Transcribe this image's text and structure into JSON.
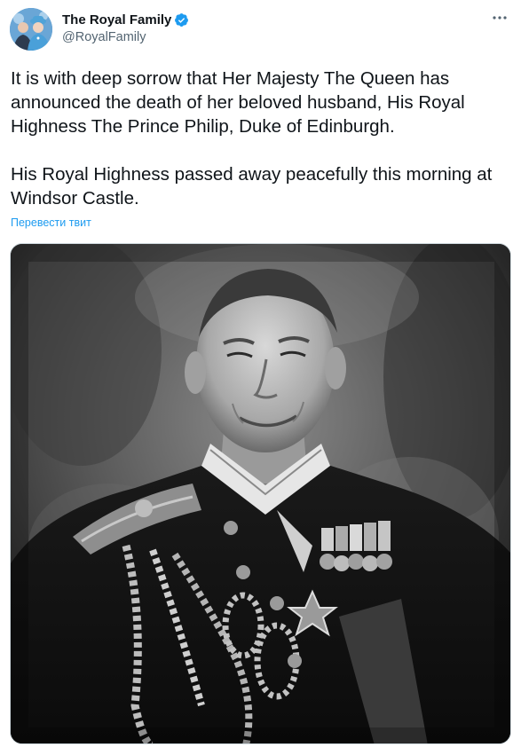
{
  "tweet": {
    "author": {
      "display_name": "The Royal Family",
      "handle": "@RoyalFamily",
      "verified": true
    },
    "more_icon": "more-horizontal-icon",
    "text_paragraphs": [
      "It is with deep sorrow that Her Majesty The Queen has announced the death of her beloved husband, His Royal Highness The Prince Philip, Duke of Edinburgh.",
      "His Royal Highness passed away peacefully this morning at Windsor Castle."
    ],
    "translate_label": "Перевести твит",
    "media": {
      "type": "photo",
      "description_icon": "portrait-photo"
    }
  },
  "colors": {
    "link": "#1d9bf0",
    "verified_badge": "#1d9bf0",
    "secondary_text": "#536471",
    "primary_text": "#0f1419"
  }
}
